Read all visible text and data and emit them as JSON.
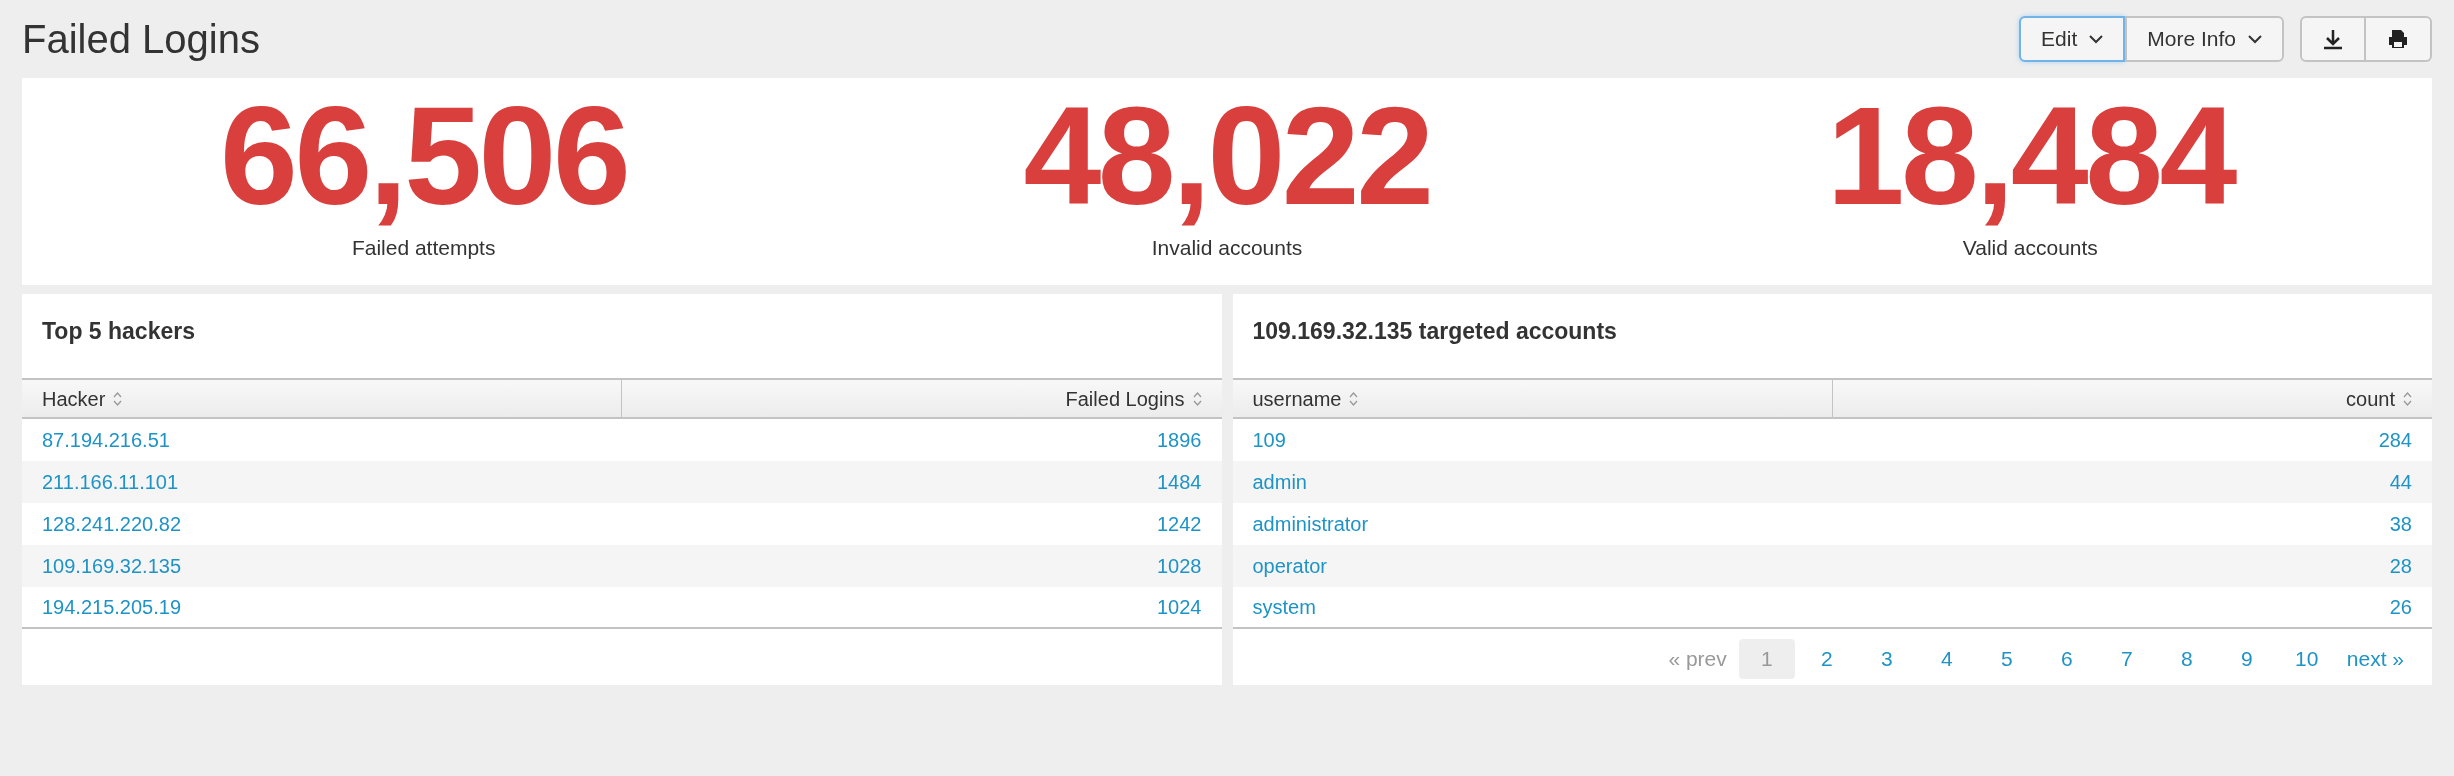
{
  "title": "Failed Logins",
  "toolbar": {
    "menus": [
      {
        "label": "Edit",
        "selected": true
      },
      {
        "label": "More Info",
        "selected": false
      }
    ]
  },
  "stats": [
    {
      "value": "66,506",
      "label": "Failed attempts"
    },
    {
      "value": "48,022",
      "label": "Invalid accounts"
    },
    {
      "value": "18,484",
      "label": "Valid accounts"
    }
  ],
  "tables": [
    {
      "title": "Top 5 hackers",
      "columns": [
        "Hacker",
        "Failed Logins"
      ],
      "rows": [
        [
          "87.194.216.51",
          "1896"
        ],
        [
          "211.166.11.101",
          "1484"
        ],
        [
          "128.241.220.82",
          "1242"
        ],
        [
          "109.169.32.135",
          "1028"
        ],
        [
          "194.215.205.19",
          "1024"
        ]
      ]
    },
    {
      "title": "109.169.32.135 targeted accounts",
      "columns": [
        "username",
        "count"
      ],
      "rows": [
        [
          "109",
          "284"
        ],
        [
          "admin",
          "44"
        ],
        [
          "administrator",
          "38"
        ],
        [
          "operator",
          "28"
        ],
        [
          "system",
          "26"
        ]
      ],
      "pagination": {
        "prev": {
          "label": "« prev",
          "disabled": true
        },
        "pages": [
          {
            "label": "1",
            "selected": true
          },
          {
            "label": "2",
            "selected": false
          },
          {
            "label": "3",
            "selected": false
          },
          {
            "label": "4",
            "selected": false
          },
          {
            "label": "5",
            "selected": false
          },
          {
            "label": "6",
            "selected": false
          },
          {
            "label": "7",
            "selected": false
          },
          {
            "label": "8",
            "selected": false
          },
          {
            "label": "9",
            "selected": false
          },
          {
            "label": "10",
            "selected": false
          }
        ],
        "next": {
          "label": "next »",
          "disabled": false
        }
      }
    }
  ]
}
